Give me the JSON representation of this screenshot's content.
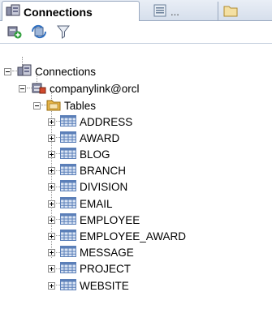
{
  "tabs": {
    "connections": "Connections",
    "second": "...",
    "third": ""
  },
  "toolbar": {
    "new_connection": "add-connection-icon",
    "refresh": "refresh-icon",
    "filter": "filter-icon"
  },
  "tree": {
    "root": "Connections",
    "connection": "companylink@orcl",
    "folder": "Tables",
    "tables": [
      "ADDRESS",
      "AWARD",
      "BLOG",
      "BRANCH",
      "DIVISION",
      "EMAIL",
      "EMPLOYEE",
      "EMPLOYEE_AWARD",
      "MESSAGE",
      "PROJECT",
      "WEBSITE"
    ]
  },
  "colors": {
    "tab_border": "#9aa9c0",
    "table_icon": "#5b7fb8",
    "folder_icon": "#e7b64a"
  }
}
